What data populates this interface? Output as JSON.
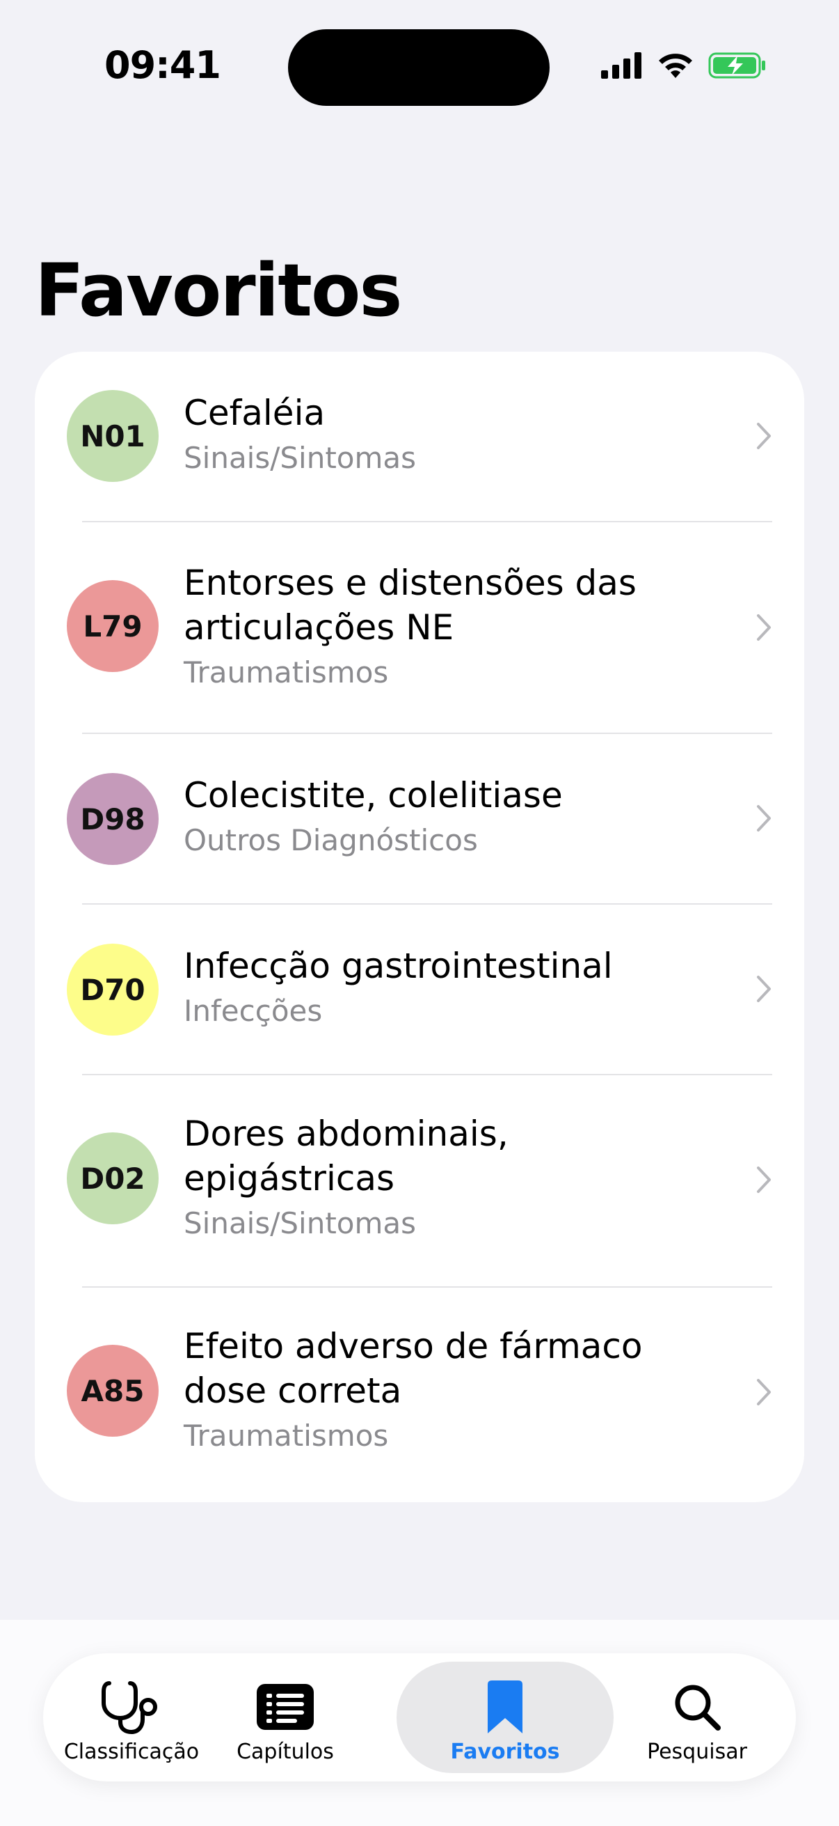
{
  "status": {
    "time": "09:41"
  },
  "title": "Favoritos",
  "favorites": [
    {
      "code": "N01",
      "title_lines": [
        "Cefaléia"
      ],
      "subtitle": "Sinais/Sintomas",
      "color": "#c3dfb0"
    },
    {
      "code": "L79",
      "title_lines": [
        "Entorses e distensões das",
        "articulações NE"
      ],
      "subtitle": "Traumatismos",
      "color": "#eb9898"
    },
    {
      "code": "D98",
      "title_lines": [
        "Colecistite, colelitiase"
      ],
      "subtitle": "Outros Diagnósticos",
      "color": "#c59aba"
    },
    {
      "code": "D70",
      "title_lines": [
        "Infecção gastrointestinal"
      ],
      "subtitle": "Infecções",
      "color": "#fdfd8a"
    },
    {
      "code": "D02",
      "title_lines": [
        "Dores abdominais,",
        "epigástricas"
      ],
      "subtitle": "Sinais/Sintomas",
      "color": "#c3dfb0"
    },
    {
      "code": "A85",
      "title_lines": [
        "Efeito adverso de fármaco",
        "dose correta"
      ],
      "subtitle": "Traumatismos",
      "color": "#eb9898"
    }
  ],
  "tabs": [
    {
      "label": "Classificação",
      "icon": "stethoscope-icon"
    },
    {
      "label": "Capítulos",
      "icon": "list-icon"
    },
    {
      "label": "Favoritos",
      "icon": "bookmark-icon",
      "active": true
    },
    {
      "label": "Pesquisar",
      "icon": "search-icon"
    }
  ],
  "colors": {
    "accent": "#1a7cf2",
    "background": "#f2f2f7",
    "subtitle": "#8a8a8e"
  }
}
